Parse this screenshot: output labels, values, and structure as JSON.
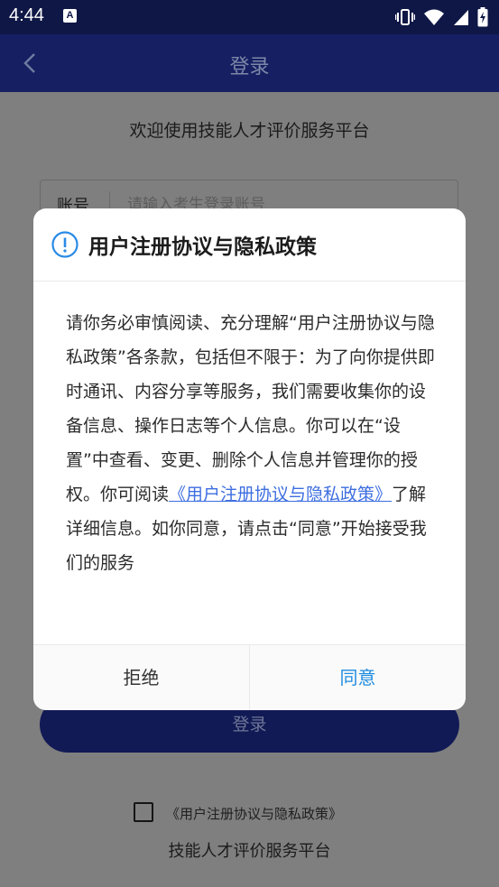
{
  "status_bar": {
    "time": "4:44",
    "notification_letter": "A",
    "icons": [
      "vibrate-icon",
      "wifi-icon",
      "signal-icon",
      "battery-charging-icon"
    ]
  },
  "nav": {
    "title": "登录"
  },
  "welcome": "欢迎使用技能人才评价服务平台",
  "account": {
    "label": "账号",
    "placeholder": "请输入考生登录账号"
  },
  "login_button": "登录",
  "agreement_checkbox_label": "《用户注册协议与隐私政策》",
  "footer": "技能人才评价服务平台",
  "dialog": {
    "title": "用户注册协议与隐私政策",
    "body_before_link": "请你务必审慎阅读、充分理解“用户注册协议与隐私政策”各条款，包括但不限于：为了向你提供即时通讯、内容分享等服务，我们需要收集你的设备信息、操作日志等个人信息。你可以在“设置”中查看、变更、删除个人信息并管理你的授权。你可阅读",
    "link_text": "《用户注册协议与隐私政策》",
    "body_after_link": "了解详细信息。如你同意，请点击“同意”开始接受我们的服务",
    "reject_label": "拒绝",
    "agree_label": "同意"
  },
  "colors": {
    "status_bar": "#0f1746",
    "nav_bar": "#151f62",
    "link": "#3d6ee0",
    "agree": "#1f8be0",
    "info_icon": "#2a8be6"
  }
}
